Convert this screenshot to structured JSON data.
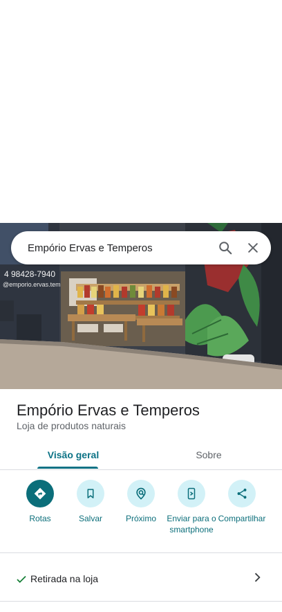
{
  "search": {
    "query": "Empório Ervas e Temperos"
  },
  "place": {
    "title": "Empório Ervas e Temperos",
    "category": "Loja de produtos naturais"
  },
  "tabs": [
    {
      "label": "Visão geral",
      "active": true
    },
    {
      "label": "Sobre",
      "active": false
    }
  ],
  "actions": [
    {
      "label": "Rotas",
      "icon": "directions-icon"
    },
    {
      "label": "Salvar",
      "icon": "bookmark-icon"
    },
    {
      "label": "Próximo",
      "icon": "nearby-icon"
    },
    {
      "label": "Enviar para o smartphone",
      "icon": "send-to-phone-icon"
    },
    {
      "label": "Compartilhar",
      "icon": "share-icon"
    }
  ],
  "photo": {
    "sign_text": "4 98428-7940",
    "sign_subtext": "@emporio.ervas.temperos"
  },
  "pickup": {
    "label": "Retirada na loja"
  },
  "colors": {
    "accent": "#0b6e7a",
    "accent_light": "#d2f1f7",
    "active_tab": "#0b7285"
  }
}
